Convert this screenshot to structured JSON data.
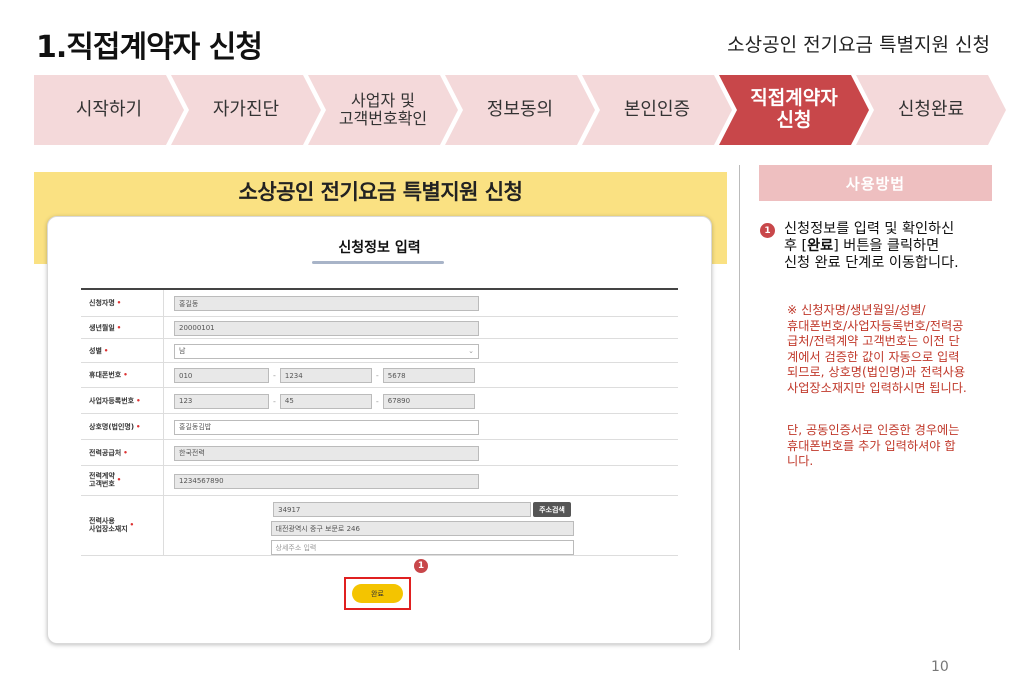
{
  "header": {
    "title": "1.직접계약자 신청",
    "subtitle": "소상공인 전기요금 특별지원 신청"
  },
  "steps": [
    {
      "label": "시작하기",
      "active": false
    },
    {
      "label": "자가진단",
      "active": false
    },
    {
      "label": "사업자 및\n고객번호확인",
      "active": false
    },
    {
      "label": "정보동의",
      "active": false
    },
    {
      "label": "본인인증",
      "active": false
    },
    {
      "label": "직접계약자\n신청",
      "active": true
    },
    {
      "label": "신청완료",
      "active": false
    }
  ],
  "colors": {
    "step_inactive": "#f4d9da",
    "step_active": "#c8474a",
    "banner": "#fae182",
    "usage_header": "#eebfc0",
    "note_text": "#c0392b"
  },
  "screenshot": {
    "header": "소상공인 전기요금 특별지원 신청",
    "card_title": "신청정보 입력",
    "fields": {
      "name": {
        "label": "신청자명",
        "value": "홍길동"
      },
      "birth": {
        "label": "생년월일",
        "value": "20000101"
      },
      "gender": {
        "label": "성별",
        "value": "남"
      },
      "phone": {
        "label": "휴대폰번호",
        "p1": "010",
        "p2": "1234",
        "p3": "5678"
      },
      "bizno": {
        "label": "사업자등록번호",
        "p1": "123",
        "p2": "45",
        "p3": "67890"
      },
      "company": {
        "label": "상호명(법인명)",
        "value": "홍길동김밥"
      },
      "supplier": {
        "label": "전력공급처",
        "value": "한국전력"
      },
      "custno": {
        "label": "전력계약\n고객번호",
        "value": "1234567890"
      },
      "address": {
        "label": "전력사용\n사업장소재지",
        "zip": "34917",
        "search_button": "주소검색",
        "addr1": "대전광역시 중구 보문로 246",
        "addr2_placeholder": "상세주소 입력"
      }
    },
    "required_mark": "•",
    "dash": "-",
    "done_button": "완료",
    "badge": "1"
  },
  "usage": {
    "header": "사용방법",
    "badge": "1",
    "line1": "신청정보를 입력 및 확인하신",
    "line2_pre": "후 [",
    "line2_bold": "완료",
    "line2_post": "] 버튼을 클릭하면",
    "line3": "신청 완료 단계로 이동합니다.",
    "note1": "※ 신청자명/생년월일/성별/\n휴대폰번호/사업자등록번호/전력공\n급처/전력계약 고객번호는 이전 단\n계에서 검증한 값이 자동으로 입력\n되므로, 상호명(법인명)과 전력사용\n사업장소재지만 입력하시면 됩니다.",
    "note2": "단, 공동인증서로 인증한 경우에는\n휴대폰번호를 추가 입력하셔야 합\n니다."
  },
  "page_number": "10"
}
